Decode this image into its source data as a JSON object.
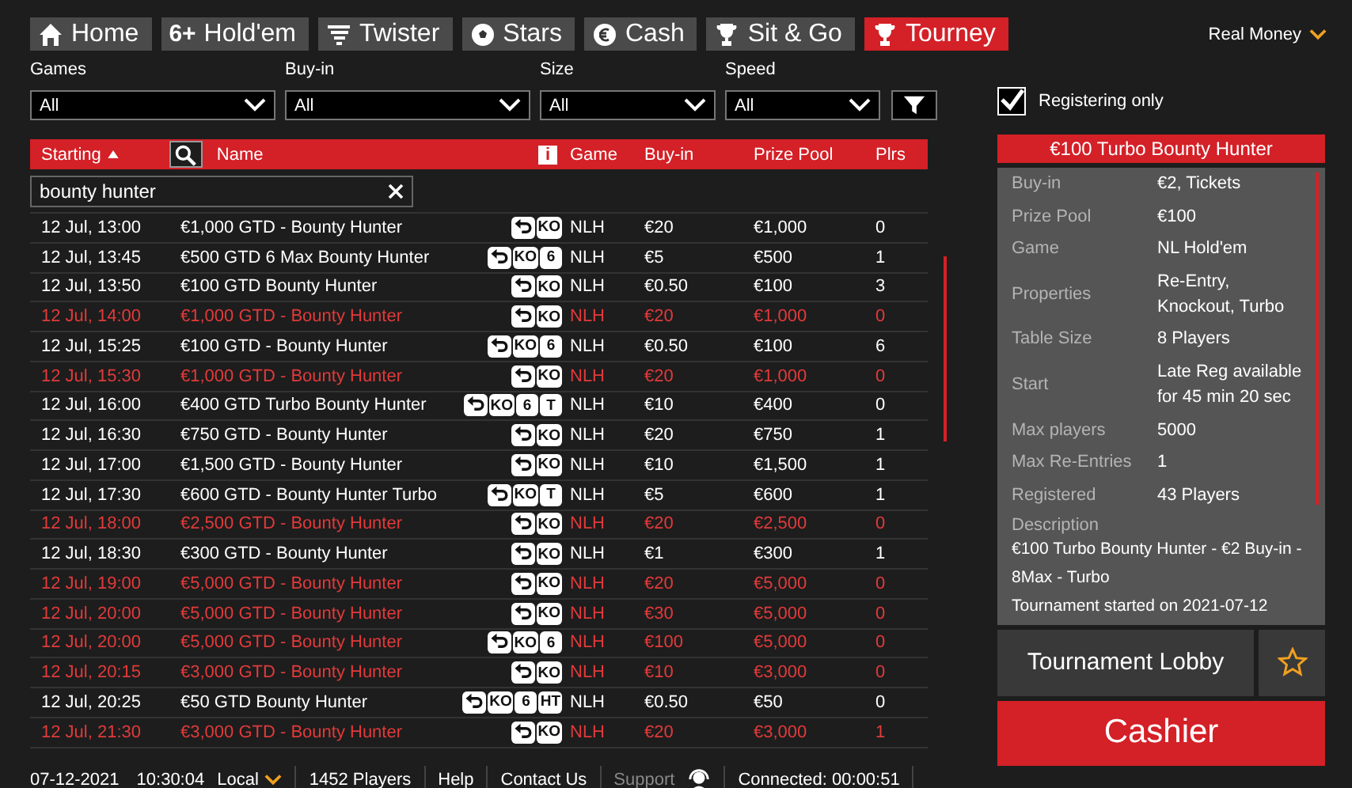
{
  "tabs": [
    {
      "kind": "home",
      "label": "Home",
      "selected": false
    },
    {
      "kind": "glyph",
      "glyph": "6+",
      "label": "Hold'em",
      "selected": false
    },
    {
      "kind": "twister",
      "label": "Twister",
      "selected": false
    },
    {
      "kind": "stars",
      "label": "Stars",
      "selected": false
    },
    {
      "kind": "cash",
      "label": "Cash",
      "selected": false
    },
    {
      "kind": "trophy",
      "label": "Sit & Go",
      "selected": false
    },
    {
      "kind": "cup",
      "label": "Tourney",
      "selected": true
    }
  ],
  "account": "Real Money",
  "filters": [
    {
      "label": "Games",
      "value": "All"
    },
    {
      "label": "Buy-in",
      "value": "All"
    },
    {
      "label": "Size",
      "value": "All"
    },
    {
      "label": "Speed",
      "value": "All"
    }
  ],
  "registering_only": {
    "label": "Registering only",
    "checked": true
  },
  "table": {
    "columns": [
      "Starting",
      "Name",
      "Game",
      "Buy-in",
      "Prize Pool",
      "Plrs"
    ],
    "info": "i",
    "search": {
      "value": "bounty hunter"
    },
    "rows": [
      {
        "start": "12 Jul, 13:00",
        "name": "€1,000 GTD - Bounty Hunter",
        "reentry": true,
        "badges": [
          "KO"
        ],
        "game": "NLH",
        "buyin": "€20",
        "prize": "€1,000",
        "plrs": "0",
        "late": false
      },
      {
        "start": "12 Jul, 13:45",
        "name": "€500 GTD 6 Max Bounty Hunter",
        "reentry": true,
        "badges": [
          "KO",
          "6"
        ],
        "game": "NLH",
        "buyin": "€5",
        "prize": "€500",
        "plrs": "1",
        "late": false
      },
      {
        "start": "12 Jul, 13:50",
        "name": "€100 GTD Bounty Hunter",
        "reentry": true,
        "badges": [
          "KO"
        ],
        "game": "NLH",
        "buyin": "€0.50",
        "prize": "€100",
        "plrs": "3",
        "late": false
      },
      {
        "start": "12 Jul, 14:00",
        "name": "€1,000 GTD - Bounty Hunter",
        "reentry": true,
        "badges": [
          "KO"
        ],
        "game": "NLH",
        "buyin": "€20",
        "prize": "€1,000",
        "plrs": "0",
        "late": true
      },
      {
        "start": "12 Jul, 15:25",
        "name": "€100 GTD - Bounty Hunter",
        "reentry": true,
        "badges": [
          "KO",
          "6"
        ],
        "game": "NLH",
        "buyin": "€0.50",
        "prize": "€100",
        "plrs": "6",
        "late": false
      },
      {
        "start": "12 Jul, 15:30",
        "name": "€1,000 GTD - Bounty Hunter",
        "reentry": true,
        "badges": [
          "KO"
        ],
        "game": "NLH",
        "buyin": "€20",
        "prize": "€1,000",
        "plrs": "0",
        "late": true
      },
      {
        "start": "12 Jul, 16:00",
        "name": "€400 GTD Turbo Bounty Hunter",
        "reentry": true,
        "badges": [
          "KO",
          "6",
          "T"
        ],
        "game": "NLH",
        "buyin": "€10",
        "prize": "€400",
        "plrs": "0",
        "late": false
      },
      {
        "start": "12 Jul, 16:30",
        "name": "€750 GTD - Bounty Hunter",
        "reentry": true,
        "badges": [
          "KO"
        ],
        "game": "NLH",
        "buyin": "€20",
        "prize": "€750",
        "plrs": "1",
        "late": false
      },
      {
        "start": "12 Jul, 17:00",
        "name": "€1,500 GTD - Bounty Hunter",
        "reentry": true,
        "badges": [
          "KO"
        ],
        "game": "NLH",
        "buyin": "€10",
        "prize": "€1,500",
        "plrs": "1",
        "late": false
      },
      {
        "start": "12 Jul, 17:30",
        "name": "€600 GTD - Bounty Hunter Turbo",
        "reentry": true,
        "badges": [
          "KO",
          "T"
        ],
        "game": "NLH",
        "buyin": "€5",
        "prize": "€600",
        "plrs": "1",
        "late": false
      },
      {
        "start": "12 Jul, 18:00",
        "name": "€2,500 GTD - Bounty Hunter",
        "reentry": true,
        "badges": [
          "KO"
        ],
        "game": "NLH",
        "buyin": "€20",
        "prize": "€2,500",
        "plrs": "0",
        "late": true
      },
      {
        "start": "12 Jul, 18:30",
        "name": "€300 GTD - Bounty Hunter",
        "reentry": true,
        "badges": [
          "KO"
        ],
        "game": "NLH",
        "buyin": "€1",
        "prize": "€300",
        "plrs": "1",
        "late": false
      },
      {
        "start": "12 Jul, 19:00",
        "name": "€5,000 GTD - Bounty Hunter",
        "reentry": true,
        "badges": [
          "KO"
        ],
        "game": "NLH",
        "buyin": "€20",
        "prize": "€5,000",
        "plrs": "0",
        "late": true
      },
      {
        "start": "12 Jul, 20:00",
        "name": "€5,000 GTD - Bounty Hunter",
        "reentry": true,
        "badges": [
          "KO"
        ],
        "game": "NLH",
        "buyin": "€30",
        "prize": "€5,000",
        "plrs": "0",
        "late": true
      },
      {
        "start": "12 Jul, 20:00",
        "name": "€5,000 GTD - Bounty Hunter",
        "reentry": true,
        "badges": [
          "KO",
          "6"
        ],
        "game": "NLH",
        "buyin": "€100",
        "prize": "€5,000",
        "plrs": "0",
        "late": true
      },
      {
        "start": "12 Jul, 20:15",
        "name": "€3,000 GTD - Bounty Hunter",
        "reentry": true,
        "badges": [
          "KO"
        ],
        "game": "NLH",
        "buyin": "€10",
        "prize": "€3,000",
        "plrs": "0",
        "late": true
      },
      {
        "start": "12 Jul, 20:25",
        "name": "€50 GTD Bounty Hunter",
        "reentry": true,
        "badges": [
          "KO",
          "6",
          "HT"
        ],
        "game": "NLH",
        "buyin": "€0.50",
        "prize": "€50",
        "plrs": "0",
        "late": false
      },
      {
        "start": "12 Jul, 21:30",
        "name": "€3,000 GTD - Bounty Hunter",
        "reentry": true,
        "badges": [
          "KO"
        ],
        "game": "NLH",
        "buyin": "€20",
        "prize": "€3,000",
        "plrs": "1",
        "late": true
      }
    ]
  },
  "details": {
    "title": "€100 Turbo Bounty Hunter",
    "fields": [
      {
        "label": "Buy-in",
        "value": "€2, Tickets"
      },
      {
        "label": "Prize Pool",
        "value": "€100"
      },
      {
        "label": "Game",
        "value": "NL Hold'em"
      },
      {
        "label": "Properties",
        "value": "Re-Entry, Knockout, Turbo"
      },
      {
        "label": "Table Size",
        "value": "8 Players"
      },
      {
        "label": "Start",
        "value": "Late Reg available for 45 min 20 sec"
      },
      {
        "label": "Max players",
        "value": "5000"
      },
      {
        "label": "Max Re-Entries",
        "value": "1"
      },
      {
        "label": "Registered",
        "value": "43 Players"
      }
    ],
    "description_label": "Description",
    "description": "€100 Turbo Bounty Hunter - €2 Buy-in - 8Max - Turbo",
    "note": "Tournament started on 2021-07-12"
  },
  "lobby_button": "Tournament Lobby",
  "cashier_button": "Cashier",
  "status_bar": {
    "date": "07-12-2021",
    "time": "10:30:04",
    "zone": "Local",
    "players": "1452 Players",
    "help": "Help",
    "contact": "Contact Us",
    "support": "Support",
    "connected": "Connected: 00:00:51"
  }
}
